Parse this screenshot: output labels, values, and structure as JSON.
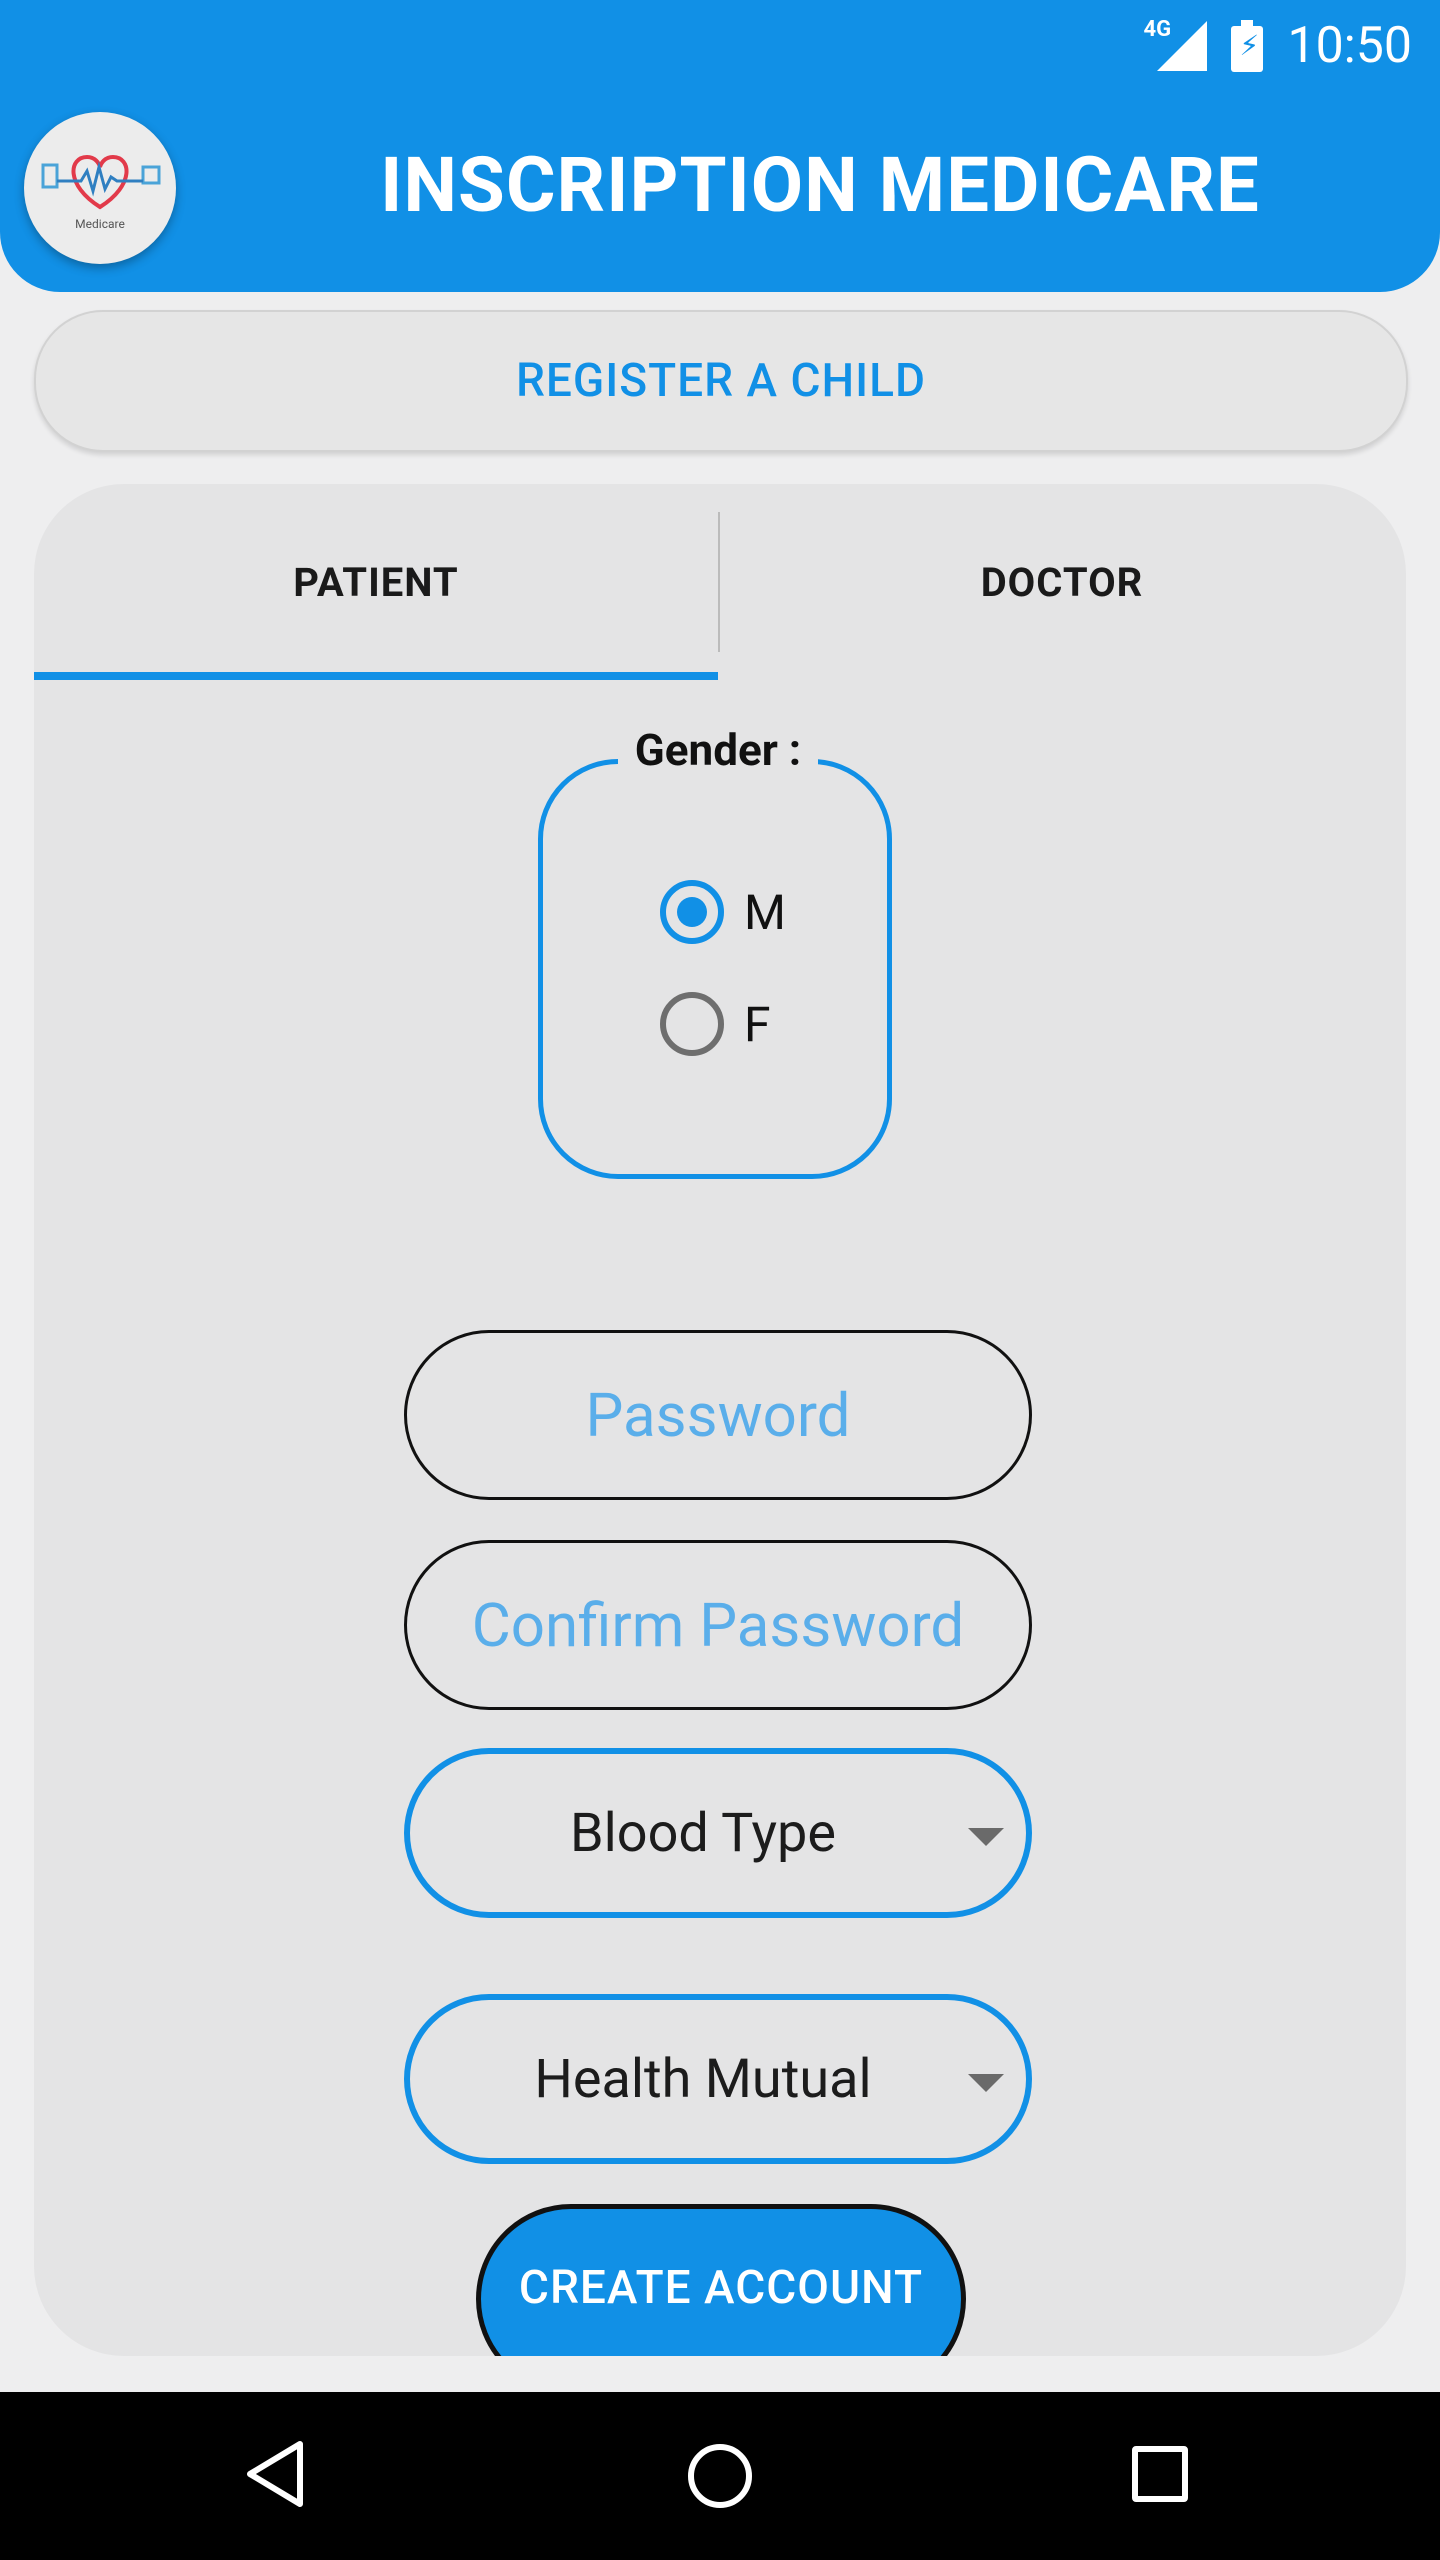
{
  "status_bar": {
    "time": "10:50",
    "network": "4G"
  },
  "header": {
    "logo_text": "Medicare",
    "title": "INSCRIPTION MEDICARE"
  },
  "register_child_label": "REGISTER A CHILD",
  "tabs": [
    {
      "label": "PATIENT",
      "selected": true
    },
    {
      "label": "DOCTOR",
      "selected": false
    }
  ],
  "gender": {
    "legend": "Gender :",
    "options": [
      {
        "label": "M",
        "checked": true
      },
      {
        "label": "F",
        "checked": false
      }
    ]
  },
  "form": {
    "password_placeholder": "Password",
    "confirm_password_placeholder": "Confirm Password",
    "blood_type": "Blood Type",
    "health_mutual": "Health Mutual",
    "create_account_label": "CREATE ACCOUNT"
  },
  "colors": {
    "accent": "#1190e6",
    "background": "#eeeeef",
    "card": "#e4e4e5"
  },
  "icons": {
    "signal": "signal-4g-icon",
    "battery": "battery-charging-icon",
    "back": "nav-back-icon",
    "home": "nav-home-icon",
    "recent": "nav-recent-icon"
  }
}
